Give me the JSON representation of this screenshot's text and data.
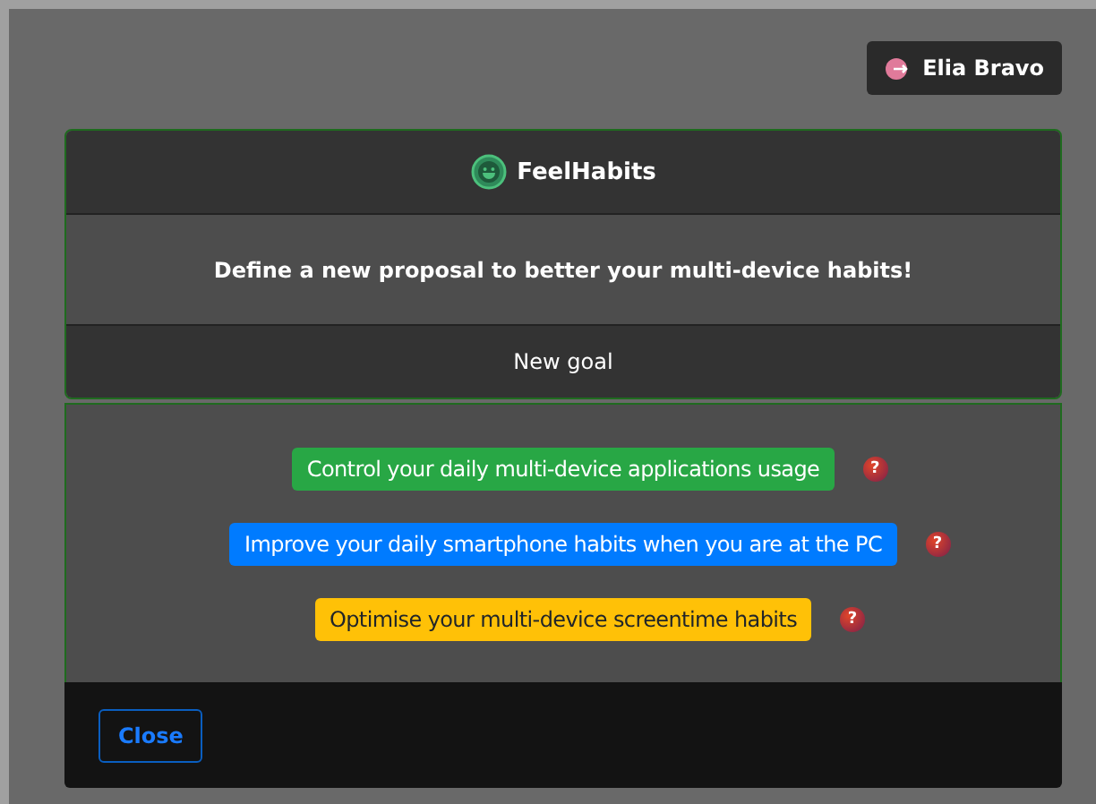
{
  "user_button": {
    "label": "Elia Bravo"
  },
  "card": {
    "title": "FeelHabits",
    "message": "Define a new proposal to better your multi-device habits!",
    "section_title": "New goal"
  },
  "goals": [
    {
      "label": "Control your daily multi-device applications usage",
      "kind": "success",
      "help": "?"
    },
    {
      "label": "Improve your daily smartphone habits when you are at the PC",
      "kind": "primary",
      "help": "?"
    },
    {
      "label": "Optimise your multi-device screentime habits",
      "kind": "warning",
      "help": "?"
    }
  ],
  "footer": {
    "close_button": "Close"
  }
}
